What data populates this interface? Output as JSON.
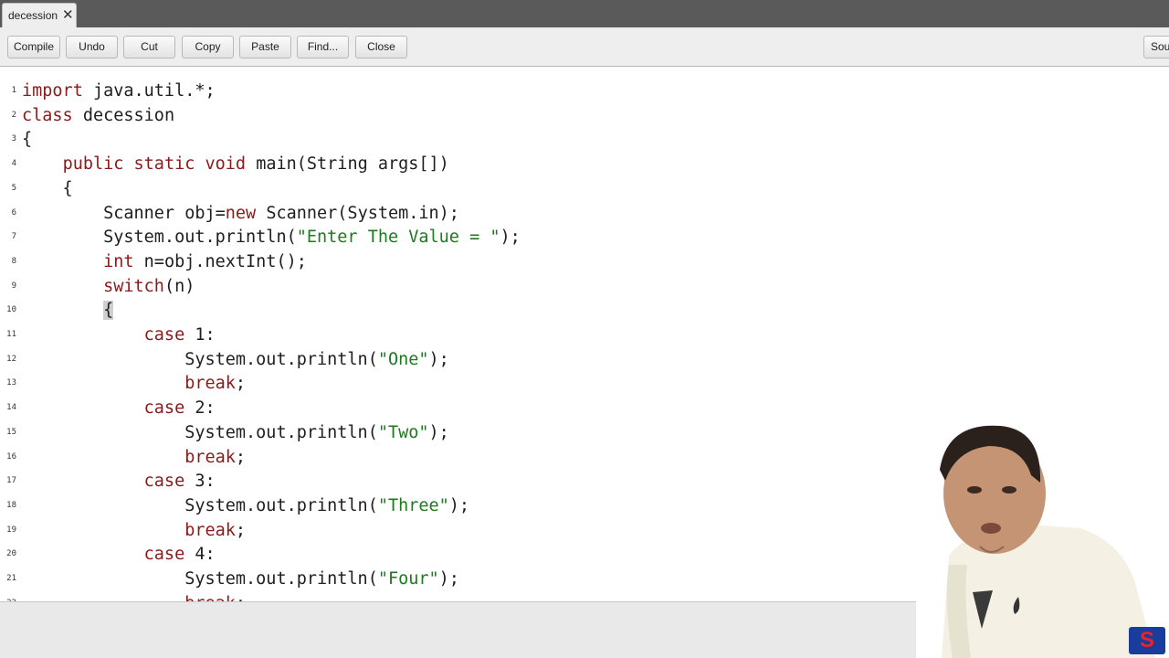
{
  "tab": {
    "label": "decession",
    "close": "✕"
  },
  "toolbar": {
    "compile": "Compile",
    "undo": "Undo",
    "cut": "Cut",
    "copy": "Copy",
    "paste": "Paste",
    "find": "Find...",
    "close": "Close",
    "source": "Sou"
  },
  "code_lines": [
    [
      {
        "t": "import",
        "c": "kw"
      },
      {
        "t": " java.util.*;"
      }
    ],
    [
      {
        "t": "class",
        "c": "kw"
      },
      {
        "t": " decession"
      }
    ],
    [
      {
        "t": "{"
      }
    ],
    [
      {
        "t": "    "
      },
      {
        "t": "public",
        "c": "kw"
      },
      {
        "t": " "
      },
      {
        "t": "static",
        "c": "kw"
      },
      {
        "t": " "
      },
      {
        "t": "void",
        "c": "kw"
      },
      {
        "t": " main(String args[])"
      }
    ],
    [
      {
        "t": "    {"
      }
    ],
    [
      {
        "t": "        Scanner obj="
      },
      {
        "t": "new",
        "c": "kw"
      },
      {
        "t": " Scanner(System.in);"
      }
    ],
    [
      {
        "t": "        System.out.println("
      },
      {
        "t": "\"Enter The Value = \"",
        "c": "str"
      },
      {
        "t": ");"
      }
    ],
    [
      {
        "t": "        "
      },
      {
        "t": "int",
        "c": "kw"
      },
      {
        "t": " n=obj.nextInt();"
      }
    ],
    [
      {
        "t": "        "
      },
      {
        "t": "switch",
        "c": "kw"
      },
      {
        "t": "(n)"
      }
    ],
    [
      {
        "t": "        "
      },
      {
        "t": "{",
        "c": "hl"
      }
    ],
    [
      {
        "t": "            "
      },
      {
        "t": "case",
        "c": "kw"
      },
      {
        "t": " 1:"
      }
    ],
    [
      {
        "t": "                System.out.println("
      },
      {
        "t": "\"One\"",
        "c": "str"
      },
      {
        "t": ");"
      }
    ],
    [
      {
        "t": "                "
      },
      {
        "t": "break",
        "c": "kw"
      },
      {
        "t": ";"
      }
    ],
    [
      {
        "t": "            "
      },
      {
        "t": "case",
        "c": "kw"
      },
      {
        "t": " 2:"
      }
    ],
    [
      {
        "t": "                System.out.println("
      },
      {
        "t": "\"Two\"",
        "c": "str"
      },
      {
        "t": ");"
      }
    ],
    [
      {
        "t": "                "
      },
      {
        "t": "break",
        "c": "kw"
      },
      {
        "t": ";"
      }
    ],
    [
      {
        "t": "            "
      },
      {
        "t": "case",
        "c": "kw"
      },
      {
        "t": " 3:"
      }
    ],
    [
      {
        "t": "                System.out.println("
      },
      {
        "t": "\"Three\"",
        "c": "str"
      },
      {
        "t": ");"
      }
    ],
    [
      {
        "t": "                "
      },
      {
        "t": "break",
        "c": "kw"
      },
      {
        "t": ";"
      }
    ],
    [
      {
        "t": "            "
      },
      {
        "t": "case",
        "c": "kw"
      },
      {
        "t": " 4:"
      }
    ],
    [
      {
        "t": "                System.out.println("
      },
      {
        "t": "\"Four\"",
        "c": "str"
      },
      {
        "t": ");"
      }
    ],
    [
      {
        "t": "                "
      },
      {
        "t": "break",
        "c": "kw"
      },
      {
        "t": ";"
      }
    ]
  ],
  "logo": {
    "letter": "S"
  },
  "colors": {
    "keyword": "#8b1a1a",
    "string": "#1d7a1d",
    "tabbar": "#5a5a5a",
    "toolbar": "#eeeeee",
    "logo_bg": "#1a3c9c",
    "logo_fg": "#e8232a"
  }
}
